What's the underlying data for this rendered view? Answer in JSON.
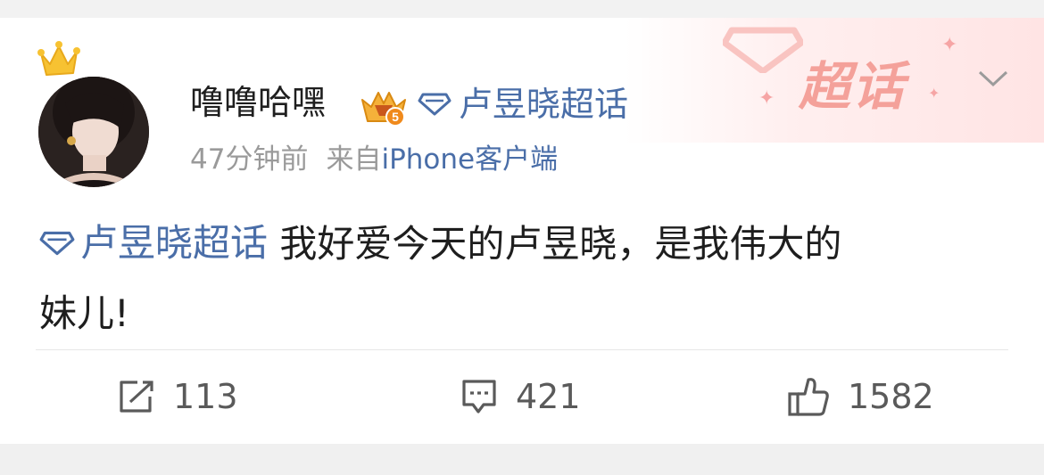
{
  "post": {
    "username": "噜噜哈嘿",
    "level_badge_number": "5",
    "topic_name": "卢昱晓超话",
    "time_ago": "47分钟前",
    "source_prefix": "来自",
    "source_device": "iPhone客户端",
    "content_topic": "卢昱晓超话",
    "content_text_1": " 我好爱今天的卢昱晓，是我伟大的",
    "content_text_2": "妹儿!"
  },
  "banner": {
    "label": "超话"
  },
  "actions": {
    "repost_count": "113",
    "comment_count": "421",
    "like_count": "1582"
  },
  "icons": {
    "crown": "crown-icon",
    "level": "level-badge-icon",
    "diamond": "super-topic-diamond-icon",
    "chevron": "chevron-down-icon",
    "repost": "repost-icon",
    "comment": "comment-icon",
    "like": "thumbs-up-icon"
  },
  "colors": {
    "link": "#4a6ea8",
    "meta": "#9a9a9a",
    "banner_text": "#f4a19a"
  }
}
